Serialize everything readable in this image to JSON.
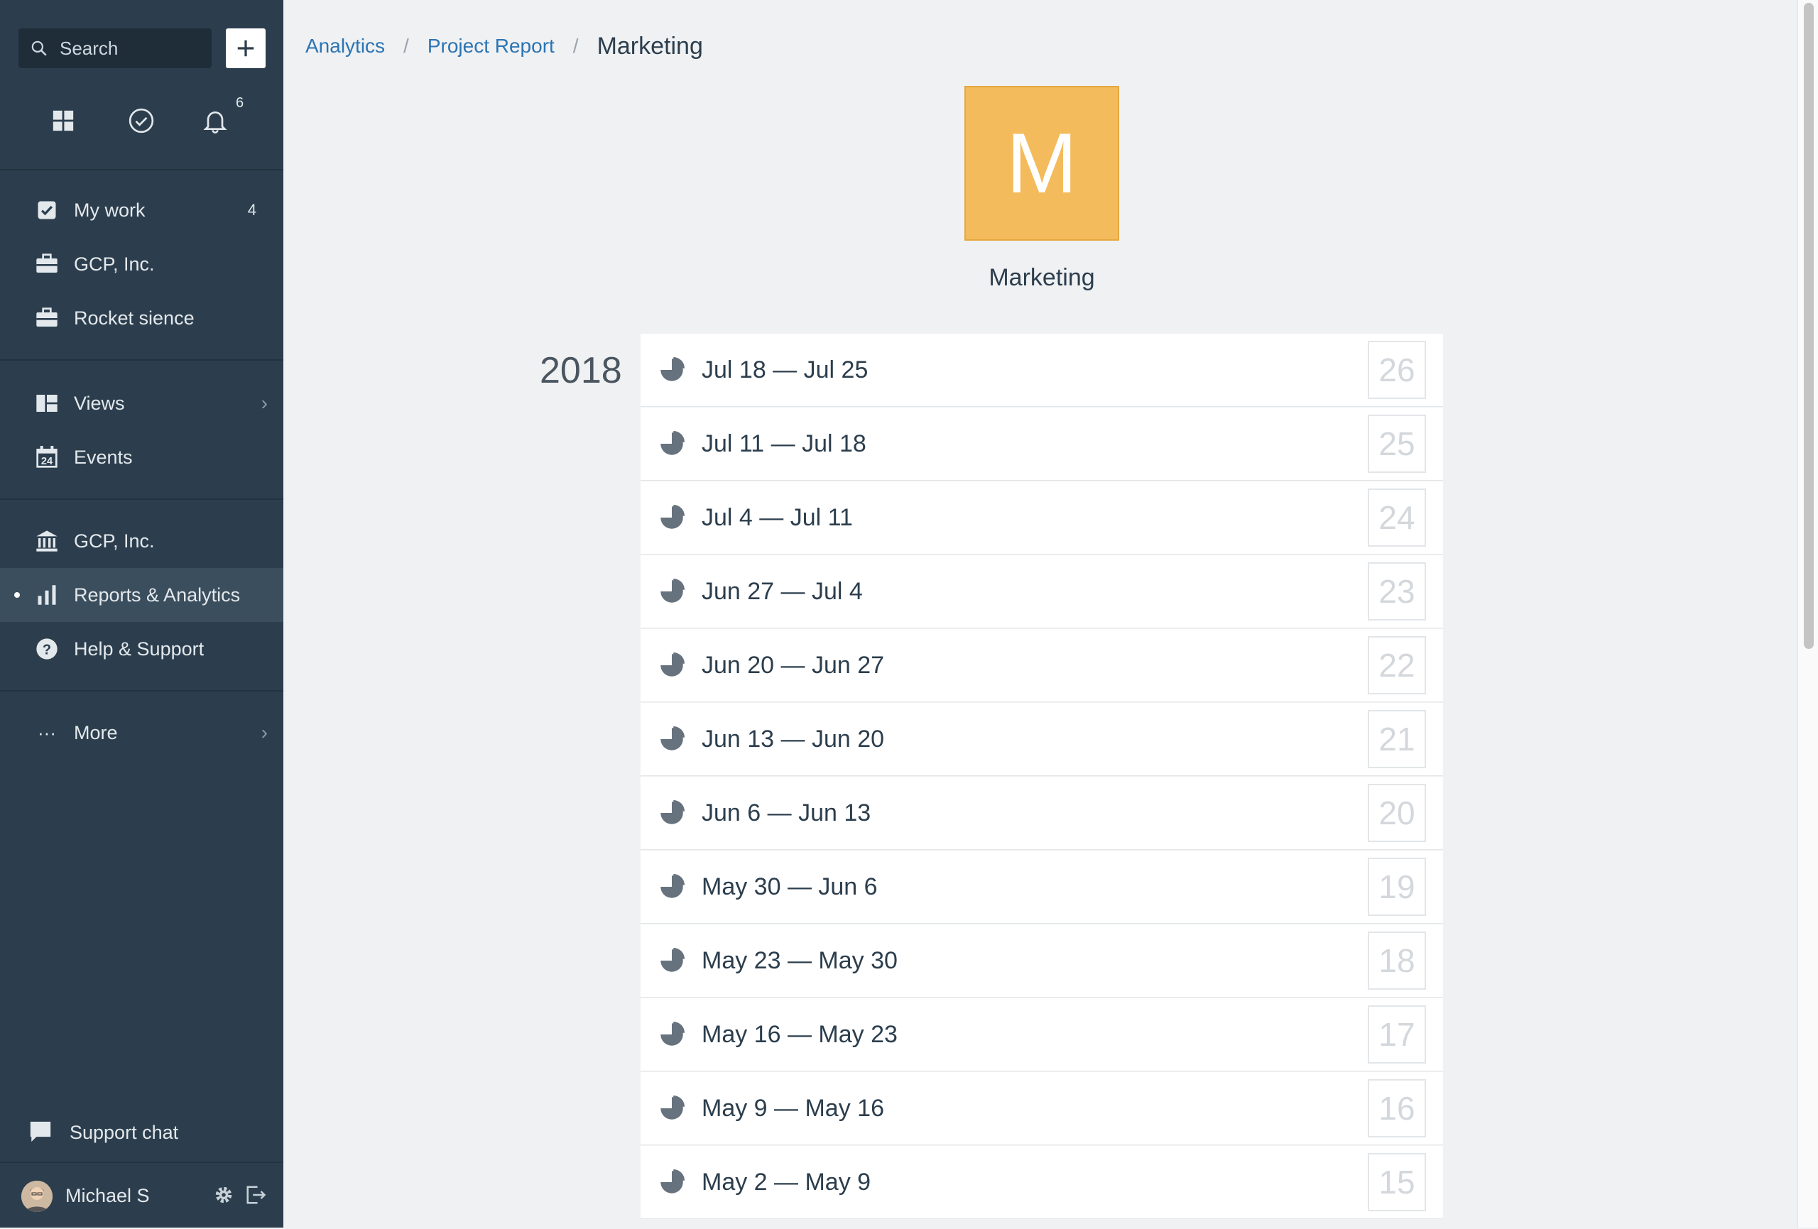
{
  "sidebar": {
    "search_placeholder": "Search",
    "notifications_count": "6",
    "items_group1": [
      {
        "label": "My work",
        "icon": "checkbox-icon",
        "count": "4"
      },
      {
        "label": "GCP, Inc.",
        "icon": "briefcase-icon"
      },
      {
        "label": "Rocket sience",
        "icon": "briefcase-icon"
      }
    ],
    "items_group2": [
      {
        "label": "Views",
        "icon": "views-icon"
      },
      {
        "label": "Events",
        "icon": "calendar-icon",
        "icon_day": "24"
      }
    ],
    "items_group3": [
      {
        "label": "GCP, Inc.",
        "icon": "bank-icon"
      },
      {
        "label": "Reports & Analytics",
        "icon": "bar-chart-icon"
      },
      {
        "label": "Help & Support",
        "icon": "help-icon"
      }
    ],
    "more_label": "More",
    "support_label": "Support chat",
    "user_name": "Michael S"
  },
  "breadcrumb": {
    "items": [
      "Analytics",
      "Project Report"
    ],
    "current": "Marketing"
  },
  "project": {
    "initial": "M",
    "name": "Marketing",
    "tile_color": "#f3bb5b"
  },
  "report": {
    "year": "2018",
    "rows": [
      {
        "range": "Jul 18 — Jul 25",
        "week": "26"
      },
      {
        "range": "Jul 11 — Jul 18",
        "week": "25"
      },
      {
        "range": "Jul 4 — Jul 11",
        "week": "24"
      },
      {
        "range": "Jun 27 — Jul 4",
        "week": "23"
      },
      {
        "range": "Jun 20 — Jun 27",
        "week": "22"
      },
      {
        "range": "Jun 13 — Jun 20",
        "week": "21"
      },
      {
        "range": "Jun 6 — Jun 13",
        "week": "20"
      },
      {
        "range": "May 30 — Jun 6",
        "week": "19"
      },
      {
        "range": "May 23 — May 30",
        "week": "18"
      },
      {
        "range": "May 16 — May 23",
        "week": "17"
      },
      {
        "range": "May 9 — May 16",
        "week": "16"
      },
      {
        "range": "May 2 — May 9",
        "week": "15"
      }
    ]
  }
}
